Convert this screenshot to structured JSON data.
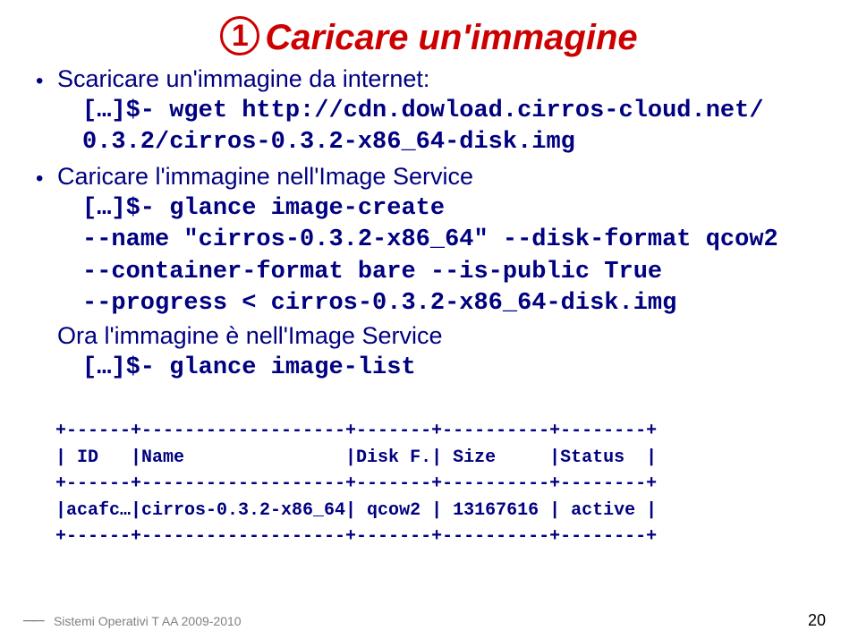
{
  "title": {
    "num": "1",
    "text": "Caricare un'immagine"
  },
  "b1": {
    "text": "Scaricare un'immagine da internet:",
    "code1": "[…]$- wget http://cdn.dowload.cirros-cloud.net/",
    "code2": "0.3.2/cirros-0.3.2-x86_64-disk.img"
  },
  "b2": {
    "text": "Caricare l'immagine nell'Image Service",
    "code1": "[…]$- glance image-create",
    "code2": "--name \"cirros-0.3.2-x86_64\" --disk-format qcow2",
    "code3": "--container-format bare --is-public True",
    "code4": "--progress < cirros-0.3.2-x86_64-disk.img"
  },
  "b3": {
    "text": "Ora l'immagine è nell'Image Service",
    "code1": "[…]$- glance image-list"
  },
  "table": {
    "sep": "+------+-------------------+-------+----------+--------+",
    "head": "| ID   |Name               |Disk F.| Size     |Status  |",
    "row": "|acafc…|cirros-0.3.2-x86_64| qcow2 | 13167616 | active |"
  },
  "footer": {
    "course": "Sistemi Operativi T AA 2009-2010",
    "page": "20"
  }
}
